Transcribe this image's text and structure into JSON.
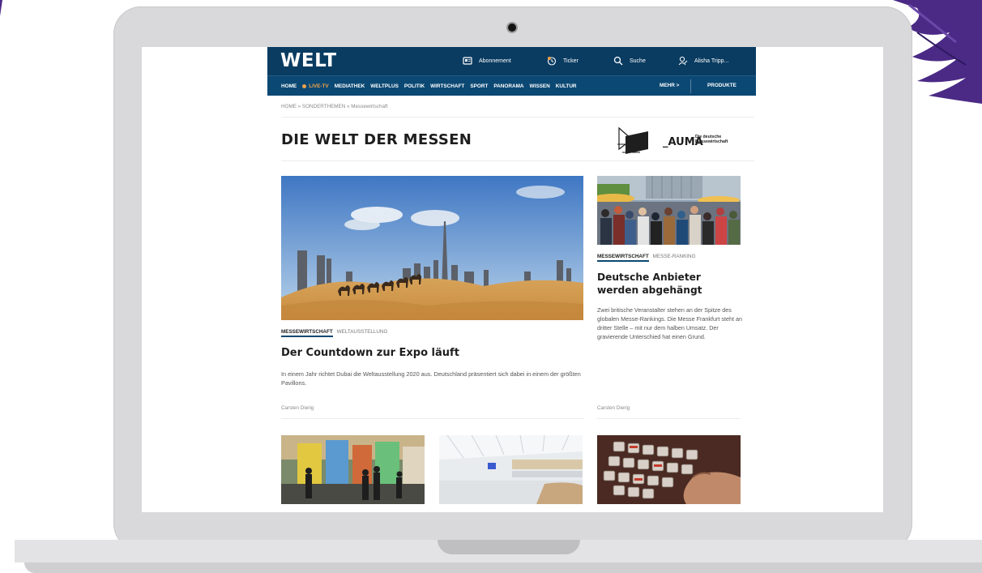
{
  "site": {
    "logo": "WELT",
    "topbar": {
      "abonnement": "Abonnement",
      "ticker": "Ticker",
      "suche": "Suche",
      "user": "Alisha Tripp..."
    },
    "nav": {
      "items": [
        "HOME",
        "MEDIATHEK",
        "WELTPLUS",
        "POLITIK",
        "WIRTSCHAFT",
        "SPORT",
        "PANORAMA",
        "WISSEN",
        "KULTUR"
      ],
      "live": "LIVE-TV",
      "mehr": "MEHR >",
      "produkte": "PRODUKTE"
    },
    "breadcrumb": "HOME » SONDERTHEMEN » Messewirtschaft",
    "page_title": "DIE WELT DER MESSEN",
    "partner": {
      "name": "_AUMA",
      "tagline_1": "Die deutsche",
      "tagline_2": "Messewirtschaft"
    }
  },
  "articles": {
    "main": {
      "kicker_primary": "MESSEWIRTSCHAFT",
      "kicker_secondary": "WELTAUSSTELLUNG",
      "headline": "Der Countdown zur Expo läuft",
      "teaser": "In einem Jahr richtet Dubai die Weltausstellung 2020 aus. Deutschland präsentiert sich dabei in einem der größten Pavillons.",
      "author": "Carsten Dierig"
    },
    "side": {
      "kicker_primary": "MESSEWIRTSCHAFT",
      "kicker_secondary": "MESSE-RANKING",
      "headline": "Deutsche Anbieter werden abgehängt",
      "teaser": "Zwei britische Veranstalter stehen an der Spitze des globalen Messe-Rankings. Die Messe Frankfurt steht an dritter Stelle – mit nur dem halben Umsatz. Der gravierende Unterschied hat einen Grund.",
      "author": "Carsten Dierig"
    }
  },
  "colors": {
    "topbar": "#0a3c61",
    "navbar": "#0b4873",
    "live": "#f0a24a",
    "brush": "#4b2a86"
  }
}
